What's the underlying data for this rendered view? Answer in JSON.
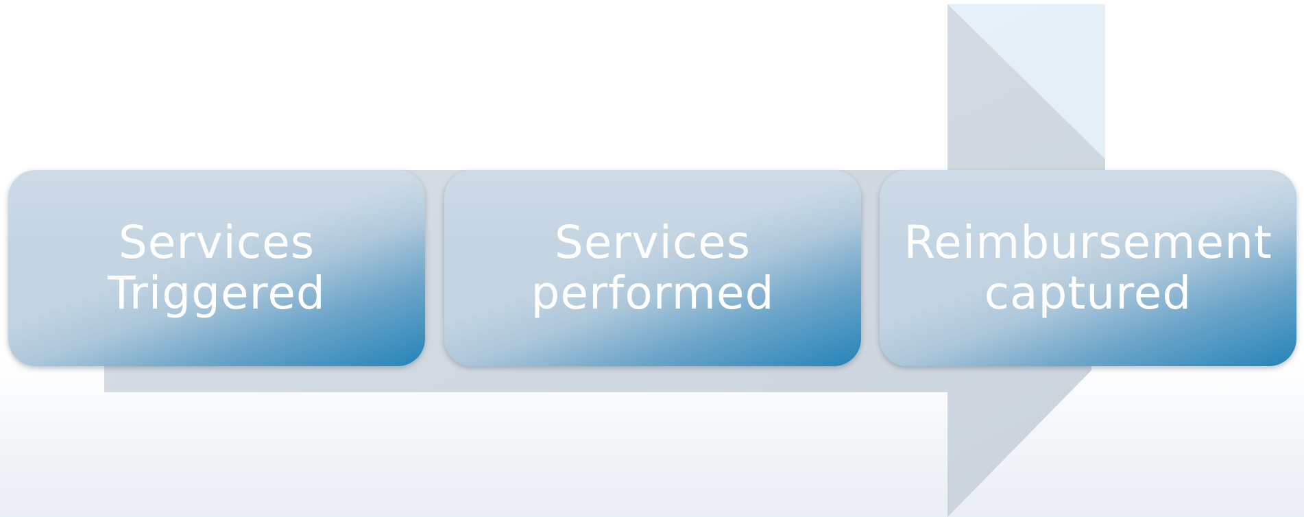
{
  "diagram": {
    "steps": [
      {
        "line1": "Services",
        "line2": "Triggered"
      },
      {
        "line1": "Services",
        "line2": "performed"
      },
      {
        "line1": "Reimbursement",
        "line2": "captured"
      }
    ],
    "colors": {
      "box_light": "#c3d4e2",
      "box_dark": "#2484b8",
      "arrow_fill": "#d4dbe3",
      "label_text": "#ffffff"
    }
  }
}
